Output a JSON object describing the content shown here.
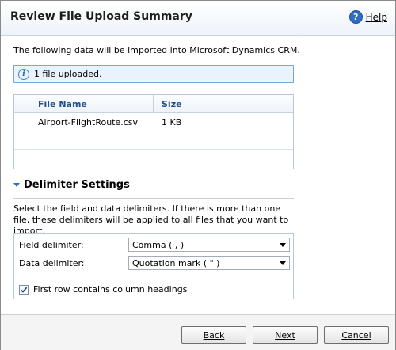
{
  "dialog": {
    "title": "Review File Upload Summary",
    "help_label": "Help"
  },
  "intro_text": "The following data will be imported into Microsoft Dynamics CRM.",
  "info_bar": {
    "icon": "info-icon",
    "text": "1 file uploaded."
  },
  "files_table": {
    "columns": [
      "File Name",
      "Size"
    ],
    "rows": [
      {
        "file_name": "Airport-FlightRoute.csv",
        "size": "1 KB"
      }
    ]
  },
  "delimiter_section": {
    "title": "Delimiter Settings",
    "description": "Select the field and data delimiters. If there is more than one file, these delimiters will be applied to all files that you want to import.",
    "field_delimiter_label": "Field delimiter:",
    "field_delimiter_value": "Comma ( , )",
    "data_delimiter_label": "Data delimiter:",
    "data_delimiter_value": "Quotation mark ( \" )",
    "first_row_headings_label": "First row contains column headings",
    "first_row_headings_checked": true
  },
  "footer": {
    "back_label": "Back",
    "next_label": "Next",
    "cancel_label": "Cancel"
  },
  "colors": {
    "accent": "#2f6fc3",
    "header_text": "#1f4e8c",
    "info_bg": "#eaf2fc"
  }
}
